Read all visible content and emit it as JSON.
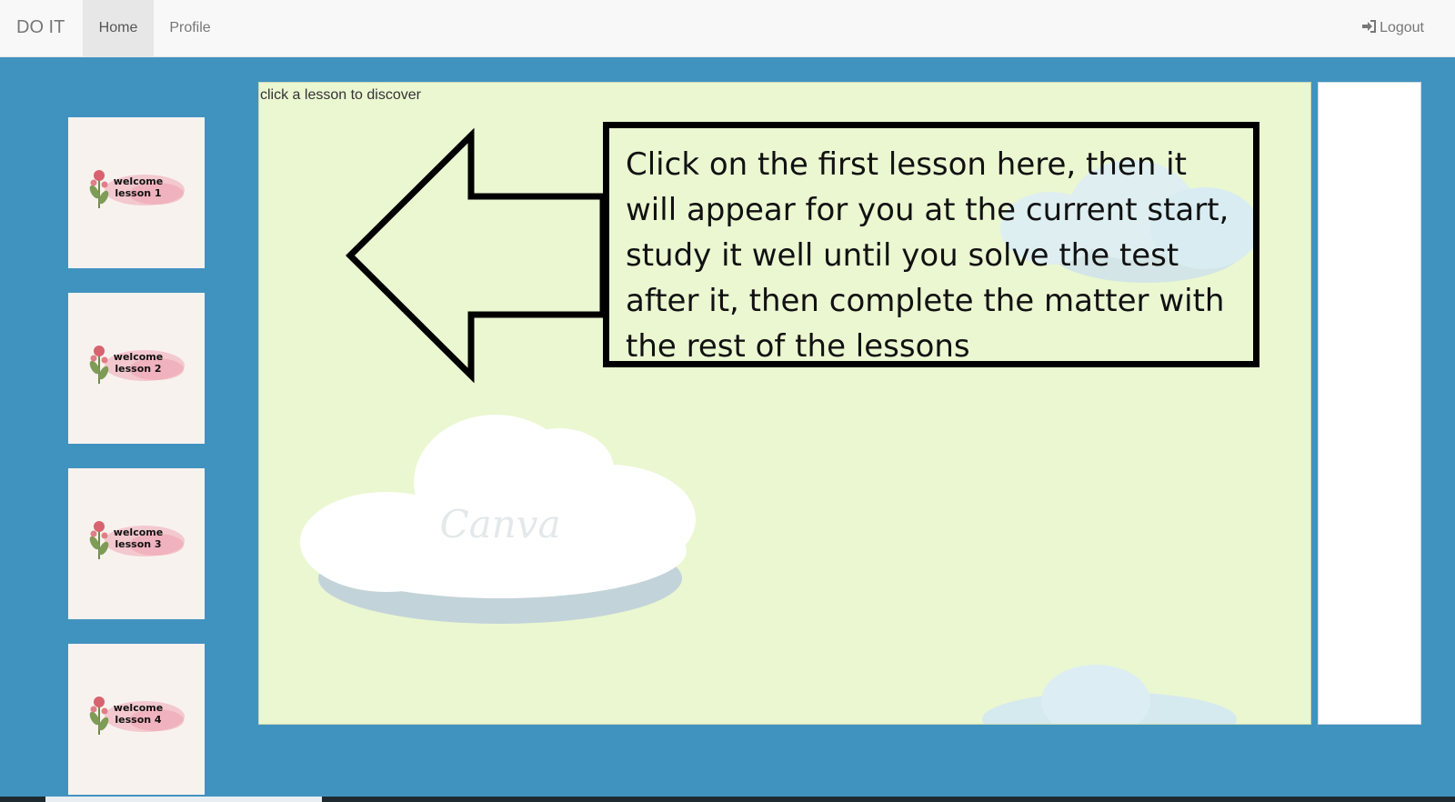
{
  "navbar": {
    "brand": "DO IT",
    "home_label": "Home",
    "profile_label": "Profile",
    "logout_label": "Logout",
    "active": "Home"
  },
  "sidebar": {
    "lessons": [
      {
        "line1": "welcome",
        "line2": "lesson 1"
      },
      {
        "line1": "welcome",
        "line2": "lesson 2"
      },
      {
        "line1": "welcome",
        "line2": "lesson 3"
      },
      {
        "line1": "welcome",
        "line2": "lesson 4"
      }
    ]
  },
  "viewer": {
    "hint": "click a lesson to discover",
    "instruction": "Click on the first lesson here, then it will appear for you at the current start, study it well until you solve the test after it, then complete the matter with the rest of the lessons",
    "watermark": "Canva"
  },
  "colors": {
    "page_bg": "#4193bf",
    "navbar_bg": "#f8f8f8",
    "viewer_bg": "#eaf7d1",
    "thumb_bg": "#f8f2ef"
  }
}
